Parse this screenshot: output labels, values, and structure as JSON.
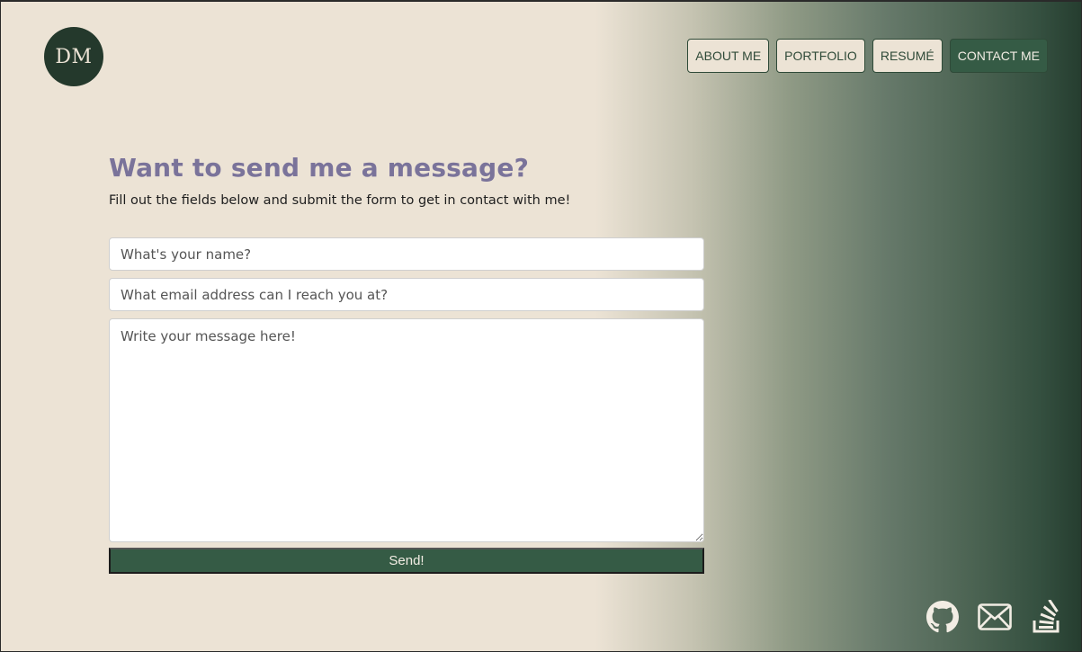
{
  "logo": {
    "initials": "DM"
  },
  "nav": {
    "items": [
      {
        "label": "ABOUT ME"
      },
      {
        "label": "PORTFOLIO"
      },
      {
        "label": "RESUMÉ"
      },
      {
        "label": "CONTACT ME"
      }
    ],
    "active": "CONTACT ME"
  },
  "contact": {
    "title": "Want to send me a message?",
    "subtitle": "Fill out the fields below and submit the form to get in contact with me!",
    "name_placeholder": "What's your name?",
    "email_placeholder": "What email address can I reach you at?",
    "message_placeholder": "Write your message here!",
    "send_label": "Send!"
  },
  "footer": {
    "icons": [
      "github-icon",
      "email-icon",
      "stack-overflow-icon"
    ]
  },
  "colors": {
    "accent": "#355b45",
    "heading": "#7a739a",
    "background": "#ece3d5",
    "logo": "#24392c"
  }
}
